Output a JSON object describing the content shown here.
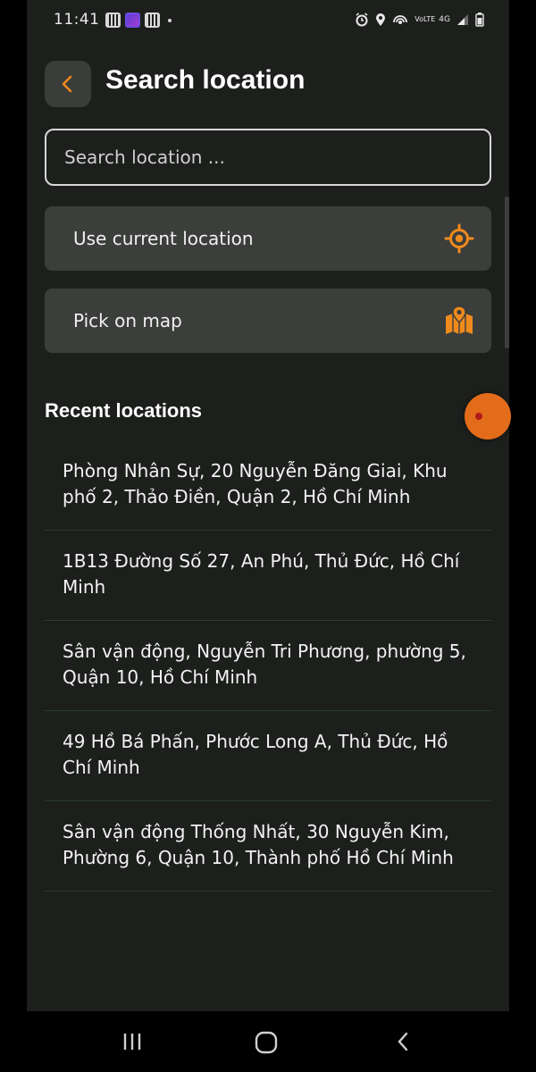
{
  "status_bar": {
    "time": "11:41",
    "icons_left": [
      "qr-icon",
      "app-icon",
      "gallery-icon",
      "dot-icon"
    ],
    "icons_right": [
      "alarm-icon",
      "location-icon",
      "hotspot-icon",
      "volte-icon",
      "signal-4g-icon",
      "signal-icon",
      "battery-icon"
    ],
    "volte_text": "VoLTE",
    "network_text": "4G"
  },
  "header": {
    "back_icon": "chevron-left-icon",
    "title": "Search location"
  },
  "search": {
    "placeholder": "Search location ...",
    "value": ""
  },
  "options": [
    {
      "label": "Use current location",
      "icon": "crosshair-icon"
    },
    {
      "label": "Pick on map",
      "icon": "map-pin-icon"
    }
  ],
  "recent": {
    "title": "Recent locations",
    "items": [
      "Phòng Nhân Sự, 20 Nguyễn Đăng Giai, Khu phố 2, Thảo Điền, Quận 2, Hồ Chí Minh",
      "1B13 Đường Số 27, An Phú, Thủ Đức, Hồ Chí Minh",
      "Sân vận động, Nguyễn Tri Phương, phường 5, Quận 10, Hồ Chí Minh",
      "49 Hồ Bá Phấn, Phước Long A, Thủ Đức, Hồ Chí Minh",
      "Sân vận động Thống Nhất, 30 Nguyễn Kim, Phường 6, Quận 10, Thành phố Hồ Chí Minh"
    ]
  },
  "nav": {
    "icons": [
      "recent-apps-icon",
      "home-icon",
      "back-icon"
    ]
  },
  "colors": {
    "accent": "#f08a1c",
    "background": "#1c1f1c",
    "card": "#3b3e3b",
    "text": "#f0f0f0"
  }
}
